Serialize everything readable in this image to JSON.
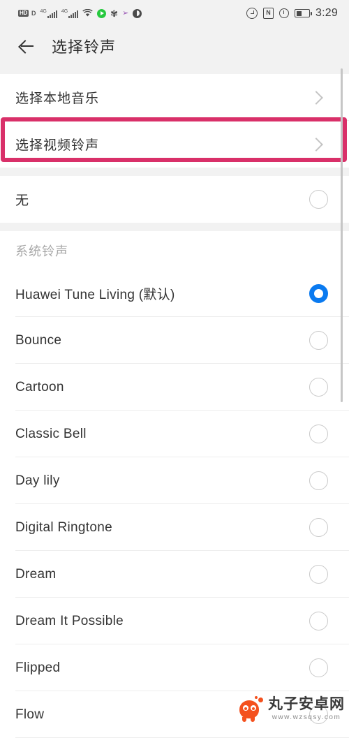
{
  "status_bar": {
    "hd_label": "HD",
    "volte_label": "D",
    "network_label_1": "4G",
    "network_label_2": "4G",
    "icons_left": [
      "hd-badge-icon",
      "volte-icon",
      "signal-4g-icon-1",
      "signal-4g-icon-2",
      "wifi-icon",
      "play-store-icon",
      "huawei-icon",
      "purple-arrow-icon",
      "circle-half-icon"
    ],
    "icons_right": [
      "do-not-disturb-icon",
      "nfc-icon",
      "alarm-icon",
      "battery-icon"
    ],
    "nfc_label": "N",
    "time": "3:29"
  },
  "app_bar": {
    "back_icon": "back-arrow-icon",
    "title": "选择铃声"
  },
  "top_actions": [
    {
      "label": "选择本地音乐",
      "chevron": "chevron-right-icon",
      "highlighted": false
    },
    {
      "label": "选择视频铃声",
      "chevron": "chevron-right-icon",
      "highlighted": true
    }
  ],
  "none_option": {
    "label": "无",
    "selected": false
  },
  "section": {
    "header": "系统铃声"
  },
  "ringtones": [
    {
      "label": "Huawei Tune Living (默认)",
      "selected": true
    },
    {
      "label": "Bounce",
      "selected": false
    },
    {
      "label": "Cartoon",
      "selected": false
    },
    {
      "label": "Classic Bell",
      "selected": false
    },
    {
      "label": "Day lily",
      "selected": false
    },
    {
      "label": "Digital Ringtone",
      "selected": false
    },
    {
      "label": "Dream",
      "selected": false
    },
    {
      "label": "Dream It Possible",
      "selected": false
    },
    {
      "label": "Flipped",
      "selected": false
    },
    {
      "label": "Flow",
      "selected": false
    }
  ],
  "colors": {
    "accent_blue": "#0a7af0",
    "highlight_pink": "#d93069",
    "background": "#ffffff",
    "chrome_gray": "#f2f2f2",
    "divider": "#ededed",
    "watermark_orange": "#f4511e"
  },
  "watermark": {
    "title": "丸子安卓网",
    "url": "www.wzsqsy.com",
    "mascot": "mascot-icon"
  }
}
